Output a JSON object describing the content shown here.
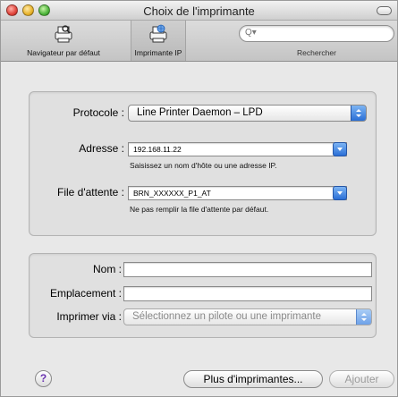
{
  "window": {
    "title": "Choix de l'imprimante"
  },
  "toolbar": {
    "nav_label": "Navigateur par défaut",
    "ip_label": "Imprimante IP",
    "search_placeholder": "",
    "search_label": "Rechercher"
  },
  "ip_group": {
    "protocol_label": "Protocole :",
    "protocol_value": "Line Printer Daemon – LPD",
    "address_label": "Adresse :",
    "address_value": "192.168.11.22",
    "address_hint": "Saisissez un nom d'hôte ou une adresse IP.",
    "queue_label": "File d'attente :",
    "queue_value": "BRN_XXXXXX_P1_AT",
    "queue_hint": "Ne pas remplir la file d'attente par défaut."
  },
  "details_group": {
    "name_label": "Nom :",
    "name_value": "",
    "location_label": "Emplacement :",
    "location_value": "",
    "print_via_label": "Imprimer via :",
    "print_via_value": "Sélectionnez un pilote ou une imprimante"
  },
  "buttons": {
    "help": "?",
    "more_printers": "Plus d'imprimantes...",
    "add": "Ajouter"
  },
  "icons": {
    "search": "magnifier-icon",
    "default_browser": "printer-magnifier-icon",
    "ip_printer": "printer-globe-icon"
  },
  "colors": {
    "accent": "#2a6fd6",
    "window_bg": "#e8e8e8"
  }
}
